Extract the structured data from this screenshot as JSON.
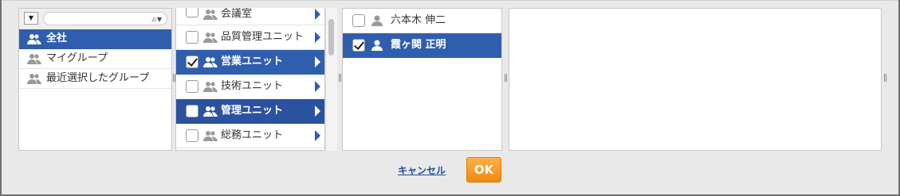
{
  "group_pane": {
    "dropdown_icon": "caret-down",
    "search_placeholder": "",
    "items": [
      {
        "label": "全社",
        "selected": true
      },
      {
        "label": "マイグループ",
        "selected": false
      },
      {
        "label": "最近選択したグループ",
        "selected": false
      }
    ]
  },
  "unit_pane": {
    "items": [
      {
        "label": "会議室",
        "checked": false
      },
      {
        "label": "品質管理ユニット",
        "checked": false
      },
      {
        "label": "営業ユニット",
        "checked": true
      },
      {
        "label": "技術ユニット",
        "checked": false
      },
      {
        "label": "管理ユニット",
        "checked": false
      },
      {
        "label": "総務ユニット",
        "checked": false
      }
    ]
  },
  "user_pane": {
    "items": [
      {
        "label": "六本木 伸二",
        "checked": false
      },
      {
        "label": "霞ヶ関 正明",
        "checked": true
      }
    ]
  },
  "footer": {
    "cancel_label": "キャンセル",
    "ok_label": "OK"
  },
  "colors": {
    "selection": "#2f5eaf",
    "ok_button": "#f39a1e",
    "link": "#1f4fa0"
  }
}
